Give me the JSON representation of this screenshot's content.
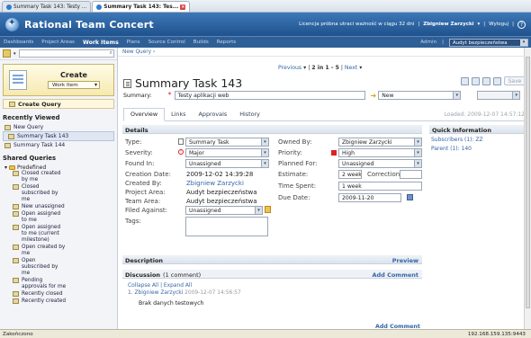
{
  "browser_tabs": [
    {
      "label": "Summary Task 143: Testy ..."
    },
    {
      "label": "Summary Task 143: Tes..."
    }
  ],
  "header": {
    "product": "Rational Team Concert",
    "license": "Licencja próbna utraci ważność w ciągu 32 dni",
    "user": "Zbigniew Zarzycki",
    "logout": "Wyloguj"
  },
  "nav": {
    "items": [
      "Dashboards",
      "Project Areas",
      "Work Items",
      "Plans",
      "Source Control",
      "Builds",
      "Reports"
    ],
    "admin": "Admin",
    "project": "Audyt bezpieczeństwa"
  },
  "sidebar": {
    "create_title": "Create",
    "create_type": "Work Item",
    "create_query": "Create Query",
    "recently_viewed_title": "Recently Viewed",
    "recent": [
      "New Query",
      "Summary Task 143",
      "Summary Task 144"
    ],
    "shared_title": "Shared Queries",
    "predefined": "Predefined",
    "queries": [
      "Closed created\nby me",
      "Closed\nsubscribed by\nme",
      "New unassigned",
      "Open assigned\nto me",
      "Open assigned\nto me (current\nmilestone)",
      "Open created by\nme",
      "Open\nsubscribed by\nme",
      "Pending\napprovals for me",
      "Recently closed",
      "Recently created"
    ]
  },
  "main": {
    "breadcrumb": "New Query ›",
    "pager": {
      "prev": "Previous",
      "range": "2 in 1 - 5",
      "next": "Next"
    },
    "title": "Summary Task 143",
    "summary_label": "Summary:",
    "summary_value": "Testy aplikacji web",
    "state": "New",
    "save": "Save",
    "tabs": [
      "Overview",
      "Links",
      "Approvals",
      "History"
    ],
    "loaded": "Loaded: 2009-12-07 14:57:12",
    "details_title": "Details",
    "fields_left": [
      {
        "label": "Type:",
        "value": "Summary Task"
      },
      {
        "label": "Severity:",
        "value": "Major"
      },
      {
        "label": "Found In:",
        "value": "Unassigned"
      },
      {
        "label": "Creation Date:",
        "value": "2009-12-02 14:39:28"
      },
      {
        "label": "Created By:",
        "value": "Zbigniew Zarzycki"
      },
      {
        "label": "Project Area:",
        "value": "Audyt bezpieczeństwa"
      },
      {
        "label": "Team Area:",
        "value": "Audyt bezpieczeństwa"
      },
      {
        "label": "Filed Against:",
        "value": "Unassigned"
      },
      {
        "label": "Tags:",
        "value": ""
      }
    ],
    "fields_right": [
      {
        "label": "Owned By:",
        "value": "Zbigniew Zarzycki"
      },
      {
        "label": "Priority:",
        "value": "High"
      },
      {
        "label": "Planned For:",
        "value": "Unassigned"
      },
      {
        "label": "Estimate:",
        "value": "2 week"
      },
      {
        "label": "Time Spent:",
        "value": "1 week"
      },
      {
        "label": "Due Date:",
        "value": "2009-11-20"
      }
    ],
    "correction_label": "Correction:",
    "quick_title": "Quick Information",
    "quick_items": [
      "Subscribers (1): ZZ",
      "Parent (1): 140"
    ],
    "description_title": "Description",
    "preview": "Preview",
    "discussion_title": "Discussion",
    "discussion_count": "(1 comment)",
    "add_comment": "Add Comment",
    "collapse_expand": "Collapse All | Expand All",
    "comment_num": "1.",
    "comment_author": "Zbigniew Zarzycki",
    "comment_date": "2009-12-07 14:56:57",
    "comment_text": "Brak danych testowych"
  },
  "status": {
    "left": "Zakończono",
    "ip": "192.168.159.135:9443"
  },
  "colors": {
    "header": "#2b63a3",
    "accent": "#3466a8"
  }
}
